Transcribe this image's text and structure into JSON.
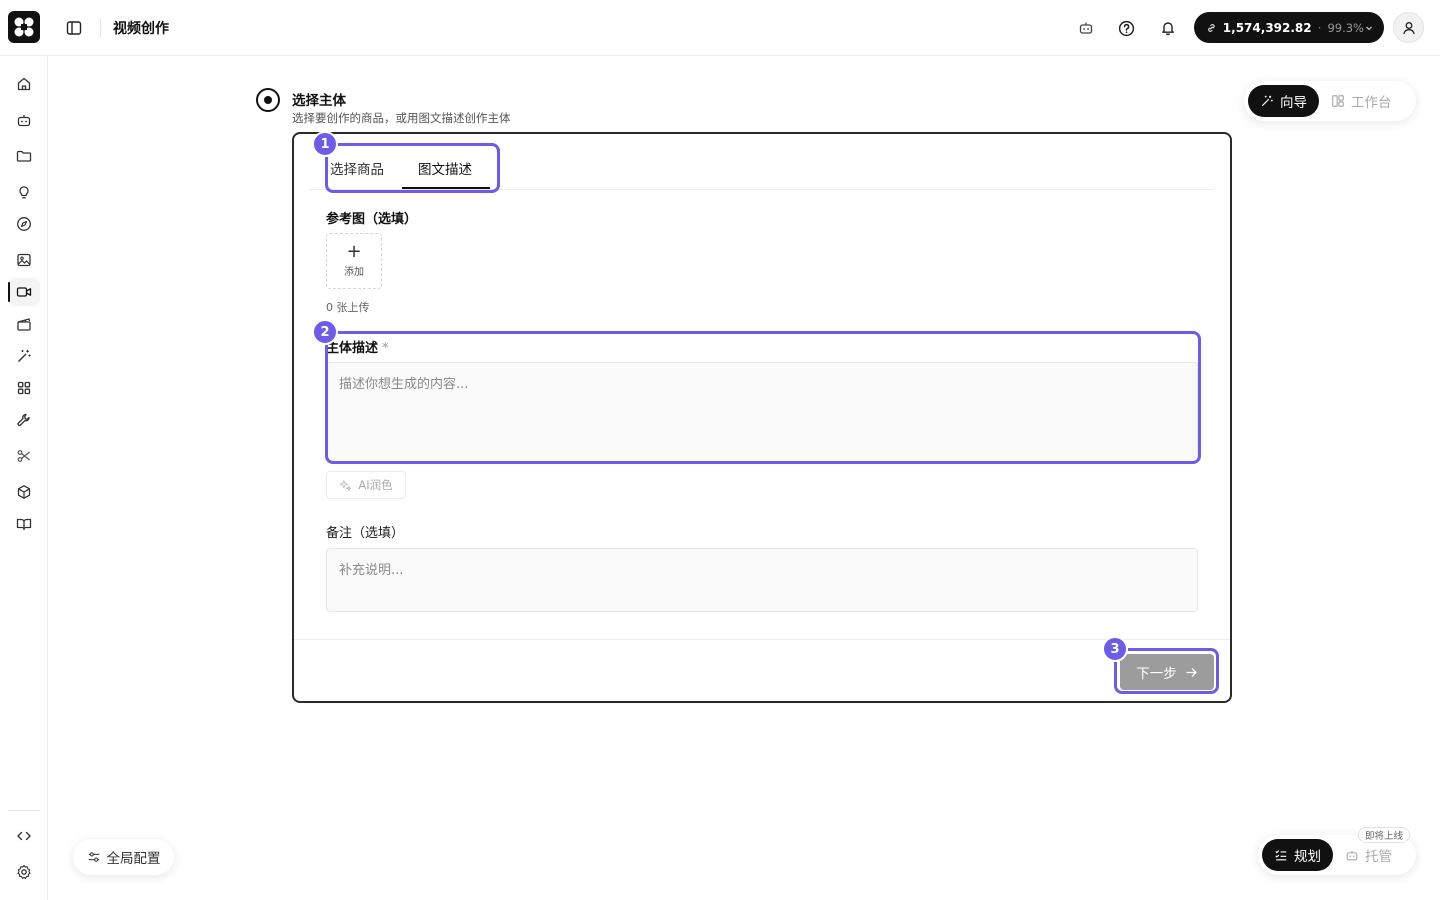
{
  "header": {
    "page_title": "视频创作",
    "balance_amount": "1,574,392.82",
    "balance_separator": "·",
    "balance_percent": "99.3%"
  },
  "step": {
    "title": "选择主体",
    "subtitle": "选择要创作的商品，或用图文描述创作主体"
  },
  "tabs": [
    {
      "label": "选择商品",
      "active": false
    },
    {
      "label": "图文描述",
      "active": true
    }
  ],
  "form": {
    "reference_label": "参考图（选填）",
    "upload_plus": "+",
    "upload_label": "添加",
    "upload_count": "0 张上传",
    "subject_label": "主体描述",
    "required_mark": "*",
    "subject_placeholder": "描述你想生成的内容...",
    "ai_polish_label": "AI润色",
    "note_label": "备注（选填）",
    "note_placeholder": "补充说明..."
  },
  "footer": {
    "next_label": "下一步"
  },
  "highlights": {
    "badge_1": "1",
    "badge_2": "2",
    "badge_3": "3",
    "color": "#6c5ce7"
  },
  "mode_toggle": {
    "guide_label": "向导",
    "workbench_label": "工作台"
  },
  "plan_toggle": {
    "plan_label": "规划",
    "managed_label": "托管",
    "soon_label": "即将上线"
  },
  "global_config": {
    "label": "全局配置"
  },
  "sidebar": {
    "items": [
      {
        "icon": "home-icon"
      },
      {
        "icon": "bot-icon"
      },
      {
        "icon": "folder-icon"
      },
      {
        "icon": "lightbulb-icon"
      },
      {
        "icon": "compass-icon"
      },
      {
        "icon": "image-icon"
      },
      {
        "icon": "video-icon",
        "active": true
      },
      {
        "icon": "clapperboard-icon"
      },
      {
        "icon": "magic-wand-icon"
      },
      {
        "icon": "grid-icon"
      },
      {
        "icon": "wrench-icon"
      },
      {
        "icon": "scissors-icon"
      },
      {
        "icon": "box-icon"
      },
      {
        "icon": "book-icon"
      }
    ],
    "bottom": [
      {
        "icon": "code-icon"
      },
      {
        "icon": "settings-icon"
      }
    ]
  }
}
